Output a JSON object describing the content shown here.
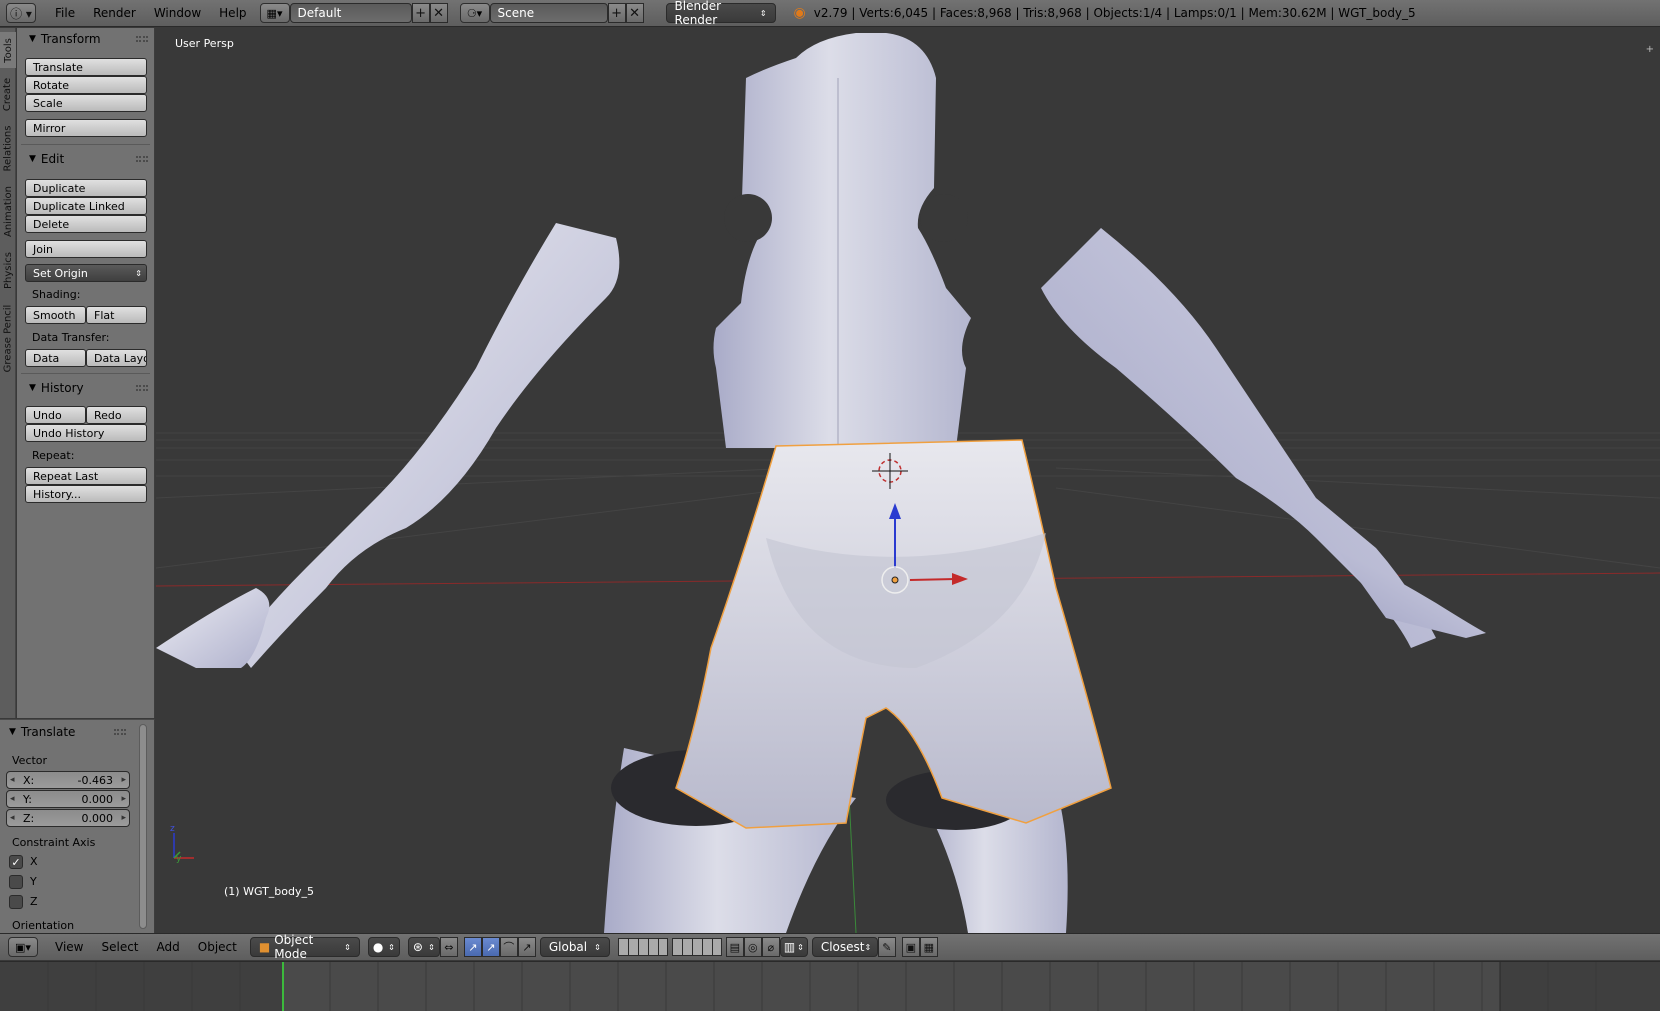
{
  "header": {
    "menus": [
      "File",
      "Render",
      "Window",
      "Help"
    ],
    "screen_layout": "Default",
    "scene": "Scene",
    "render_engine": "Blender Render",
    "stats": "v2.79 | Verts:6,045 | Faces:8,968 | Tris:8,968 | Objects:1/4 | Lamps:0/1 | Mem:30.62M | WGT_body_5"
  },
  "side_tabs": [
    "Tools",
    "Create",
    "Relations",
    "Animation",
    "Physics",
    "Grease Pencil"
  ],
  "tool_shelf": {
    "transform": {
      "title": "Transform",
      "buttons": [
        "Translate",
        "Rotate",
        "Scale",
        "Mirror"
      ]
    },
    "edit": {
      "title": "Edit",
      "buttons": [
        "Duplicate",
        "Duplicate Linked",
        "Delete",
        "Join"
      ],
      "set_origin": "Set Origin",
      "shading_label": "Shading:",
      "smooth": "Smooth",
      "flat": "Flat",
      "data_transfer_label": "Data Transfer:",
      "data": "Data",
      "data_layout": "Data Layo"
    },
    "history": {
      "title": "History",
      "undo": "Undo",
      "redo": "Redo",
      "undo_history": "Undo History",
      "repeat_label": "Repeat:",
      "repeat_last": "Repeat Last",
      "history": "History..."
    }
  },
  "operator": {
    "title": "Translate",
    "vector_label": "Vector",
    "x_label": "X:",
    "x_value": "-0.463",
    "y_label": "Y:",
    "y_value": "0.000",
    "z_label": "Z:",
    "z_value": "0.000",
    "constraint_label": "Constraint Axis",
    "constraint_x": "X",
    "constraint_y": "Y",
    "constraint_z": "Z",
    "constraint_checked": [
      true,
      false,
      false
    ],
    "orientation_label": "Orientation"
  },
  "viewport": {
    "view_label": "User Persp",
    "object_label": "(1) WGT_body_5",
    "colors": {
      "background": "#393939",
      "mesh": "#d8d9e6",
      "selection_outline": "#f0a040",
      "x_axis": "#c42a2a",
      "y_axis": "#3a9a3a",
      "z_axis": "#2a3ad0"
    }
  },
  "view_header": {
    "menus": [
      "View",
      "Select",
      "Add",
      "Object"
    ],
    "mode": "Object Mode",
    "orientation": "Global",
    "snap": "Closest"
  },
  "timeline": {
    "current_frame_color": "#3cb93c"
  }
}
